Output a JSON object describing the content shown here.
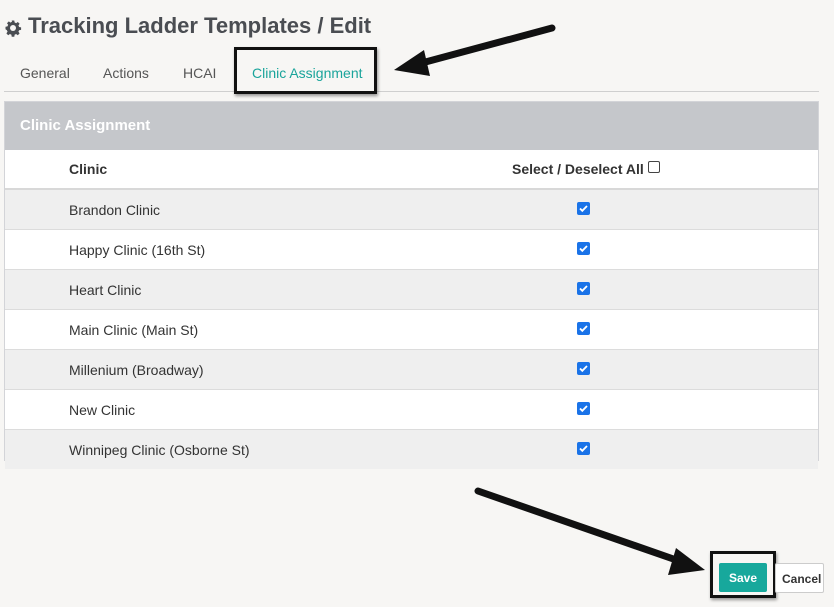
{
  "page": {
    "title": "Tracking Ladder Templates / Edit"
  },
  "tabs": [
    {
      "label": "General",
      "active": false
    },
    {
      "label": "Actions",
      "active": false
    },
    {
      "label": "HCAI",
      "active": false
    },
    {
      "label": "Clinic Assignment",
      "active": true
    }
  ],
  "panel": {
    "title": "Clinic Assignment",
    "columns": {
      "clinic": "Clinic",
      "select_all": "Select / Deselect All",
      "select_all_checked": false
    },
    "rows": [
      {
        "clinic": "Brandon Clinic",
        "checked": true
      },
      {
        "clinic": "Happy Clinic (16th St)",
        "checked": true
      },
      {
        "clinic": "Heart Clinic",
        "checked": true
      },
      {
        "clinic": "Main Clinic (Main St)",
        "checked": true
      },
      {
        "clinic": "Millenium (Broadway)",
        "checked": true
      },
      {
        "clinic": "New Clinic",
        "checked": true
      },
      {
        "clinic": "Winnipeg Clinic (Osborne St)",
        "checked": true
      }
    ]
  },
  "actions": {
    "save_label": "Save",
    "cancel_label": "Cancel"
  },
  "colors": {
    "accent": "#17a89c",
    "active_tab": "#1aa49b",
    "checkbox": "#1a73e8",
    "panel_header": "#c5c7cb"
  },
  "icons": {
    "title_icon": "gear-icon",
    "annotation": "arrow-icon"
  }
}
